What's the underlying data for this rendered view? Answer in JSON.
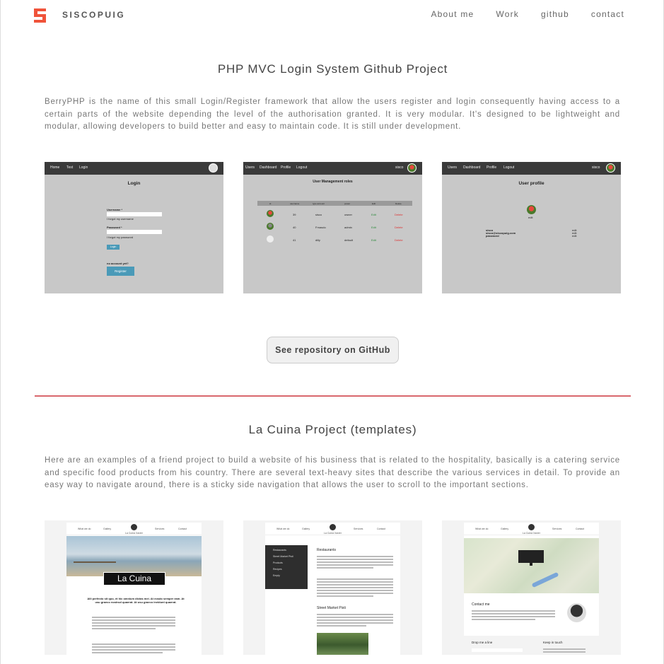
{
  "header": {
    "brand": "SISCOPUIG",
    "logo_letter": "S",
    "logo_color": "#f0533a",
    "nav": [
      "About me",
      "Work",
      "github",
      "contact"
    ]
  },
  "section1": {
    "title": "PHP MVC Login System Github Project",
    "description": "BerryPHP is the name of this small Login/Register framework that allow the users register and login consequently having access to a certain parts of the website depending the level of the authorisation granted. It is very modular. It's designed to be lightweight and modular, allowing developers to build better and easy to maintain code. It is still under development.",
    "button": "See repository on GitHub",
    "shots": {
      "login": {
        "nav": [
          "Home",
          "Test",
          "Login"
        ],
        "title": "Login",
        "username_label": "Username *",
        "username_ph": "username",
        "forgot_user": "I forgot my username",
        "password_label": "Password *",
        "forgot_pass": "I forgot my password",
        "login_btn": "Login",
        "no_account": "no account yet?",
        "register_btn": "Register"
      },
      "admin": {
        "nav": [
          "Users",
          "Dashboard",
          "Profile",
          "Logout"
        ],
        "user": "sisco",
        "title": "User Management roles",
        "headers": [
          "id",
          "username",
          "type account",
          "power",
          "Edit",
          "Delete"
        ],
        "rows": [
          [
            "39",
            "sisco",
            "owner",
            "Edit",
            "Delete"
          ],
          [
            "40",
            "Frnasdo",
            "admin",
            "Edit",
            "Delete"
          ],
          [
            "41",
            "dilly",
            "default",
            "Edit",
            "Delete"
          ]
        ]
      },
      "profile": {
        "nav": [
          "Users",
          "Dashboard",
          "Profile",
          "Logout"
        ],
        "user": "sisco",
        "title": "User profile",
        "edit": "edit",
        "fields": [
          "sisco",
          "sisco@siscopuig.com",
          "password"
        ]
      }
    }
  },
  "section2": {
    "title": "La Cuina Project (templates)",
    "description": "Here are an examples of a friend project to build a website of his business that is related to the hospitality, basically is a catering service and specific food products from his country. There are several text-heavy sites that describe the various services in detail. To provide an easy way to navigate around, there is a sticky side navigation that allows the user to scroll to the important sections.",
    "template_nav": [
      "What we do",
      "Gallery",
      "Services",
      "Contact"
    ],
    "template_brand": "La Cuina Xavier",
    "banner_text": "La Cuina",
    "tagline": "Alli perfecto sit quo, et hic omnium dictas mei. At eosdo semper eam. At usu graeco nostrud quaerat. At usu graeco invidunt quaerat.",
    "side_menu": [
      "Restaurants",
      "Street Market Pisti",
      "Products",
      "Recipes",
      "Empty"
    ],
    "side_heading_1": "Restaurants",
    "side_heading_2": "Street Market Pisti",
    "contact_heading": "Contact me",
    "drop_line": "Drop me a line",
    "keep_touch": "Keep in touch"
  }
}
